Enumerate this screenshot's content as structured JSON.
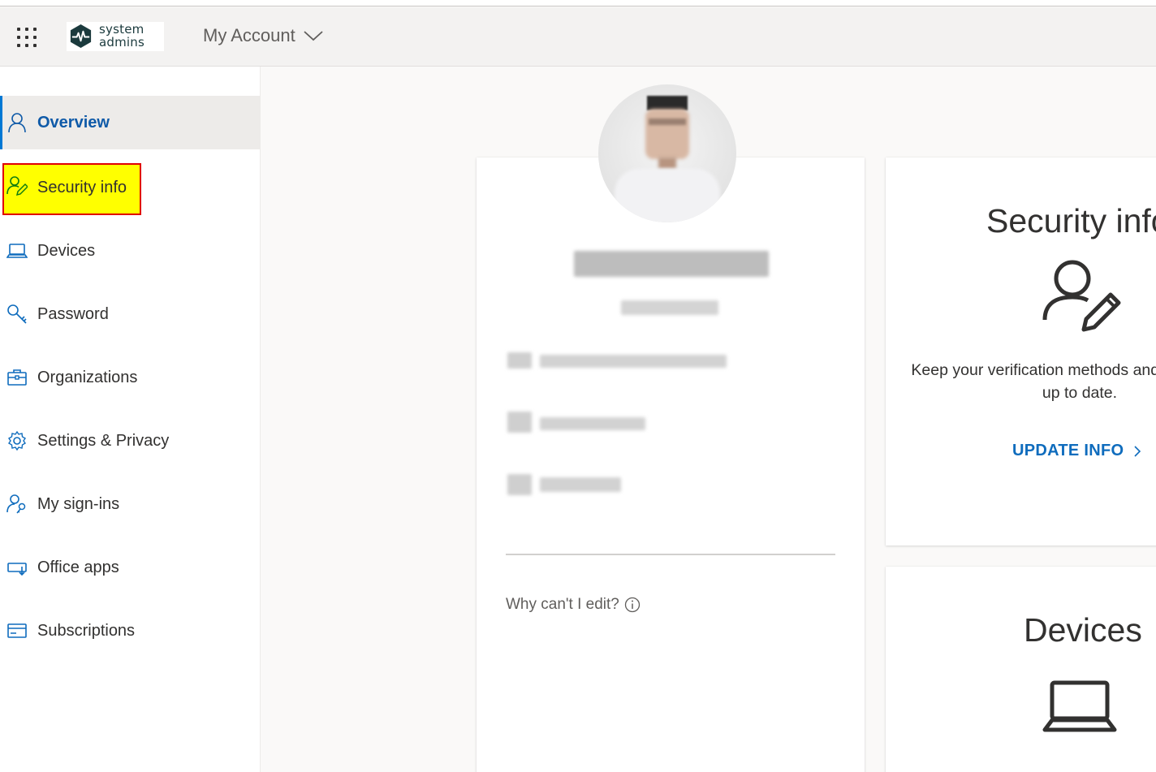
{
  "header": {
    "app_launcher_icon": "waffle-icon",
    "logo_text_line1": "system",
    "logo_text_line2": "admins",
    "app_title": "My Account",
    "title_chevron_icon": "chevron-down-icon"
  },
  "sidebar": {
    "items": [
      {
        "label": "Overview",
        "icon": "person-icon",
        "active": true
      },
      {
        "label": "Security info",
        "icon": "person-pen-icon",
        "highlighted": true
      },
      {
        "label": "Devices",
        "icon": "laptop-icon"
      },
      {
        "label": "Password",
        "icon": "key-icon"
      },
      {
        "label": "Organizations",
        "icon": "briefcase-icon"
      },
      {
        "label": "Settings & Privacy",
        "icon": "gear-icon"
      },
      {
        "label": "My sign-ins",
        "icon": "person-key-icon"
      },
      {
        "label": "Office apps",
        "icon": "apps-download-icon"
      },
      {
        "label": "Subscriptions",
        "icon": "card-icon"
      }
    ]
  },
  "profile": {
    "why_cant_edit": "Why can't I edit?",
    "info_icon": "info-icon"
  },
  "security_card": {
    "title": "Security info",
    "description": "Keep your verification methods and security info up to date.",
    "link": "UPDATE INFO",
    "icon": "person-pen-icon"
  },
  "devices_card": {
    "title": "Devices",
    "icon": "laptop-icon"
  },
  "colors": {
    "accent": "#0078d4",
    "link": "#0f6cbd",
    "highlight": "#ffff00",
    "highlight_border": "#e00000"
  }
}
